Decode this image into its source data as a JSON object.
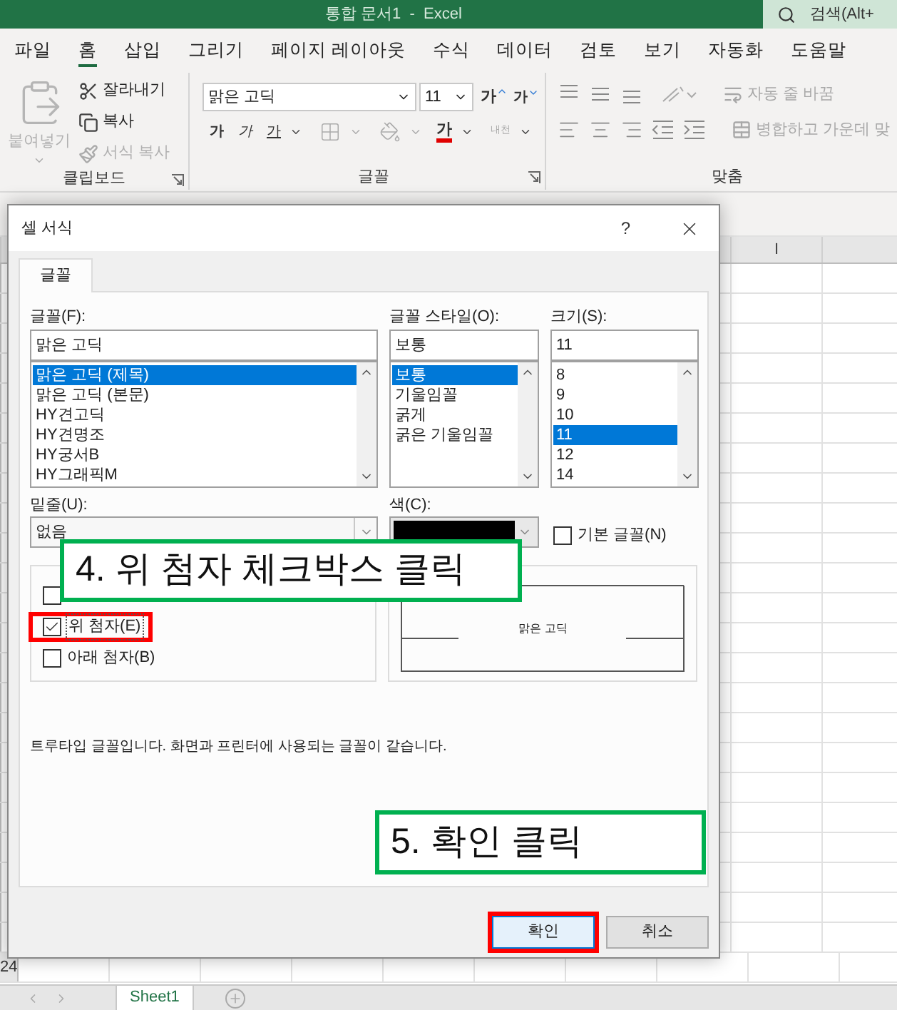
{
  "window": {
    "title": "통합 문서1  -  Excel",
    "search_placeholder": "검색(Alt+"
  },
  "menu_tabs": [
    {
      "label": "파일",
      "selected": false
    },
    {
      "label": "홈",
      "selected": true
    },
    {
      "label": "삽입",
      "selected": false
    },
    {
      "label": "그리기",
      "selected": false
    },
    {
      "label": "페이지 레이아웃",
      "selected": false
    },
    {
      "label": "수식",
      "selected": false
    },
    {
      "label": "데이터",
      "selected": false
    },
    {
      "label": "검토",
      "selected": false
    },
    {
      "label": "보기",
      "selected": false
    },
    {
      "label": "자동화",
      "selected": false
    },
    {
      "label": "도움말",
      "selected": false
    }
  ],
  "ribbon": {
    "clipboard": {
      "paste": {
        "label": "붙여넣기",
        "disabled": true
      },
      "items": [
        {
          "kind": "cut",
          "label": "잘라내기",
          "disabled": false
        },
        {
          "kind": "copy",
          "label": "복사",
          "disabled": false
        },
        {
          "kind": "format_painter",
          "label": "서식 복사",
          "disabled": true
        }
      ],
      "group_label": "클립보드"
    },
    "font": {
      "font_name": "맑은 고딕",
      "font_size": "11",
      "grow": "가",
      "shrink": "가",
      "bold": "가",
      "italic": "가",
      "underline": "가",
      "font_color": "가",
      "phonetic": "내천",
      "group_label": "글꼴"
    },
    "alignment": {
      "wrap_text": {
        "label": "자동 줄 바꿈",
        "disabled": true
      },
      "merge": {
        "label": "병합하고 가운데 맞",
        "disabled": true
      },
      "group_label": "맞춤"
    }
  },
  "sheet": {
    "column_header": "I",
    "row_number": "24",
    "sheet_tabs": [
      {
        "label": "Sheet1",
        "selected": true
      }
    ]
  },
  "dialog": {
    "title": "셀 서식",
    "help": "?",
    "tabs": [
      {
        "label": "글꼴",
        "selected": true
      }
    ],
    "font": {
      "label": "글꼴(F):",
      "value": "맑은 고딕",
      "items": [
        {
          "label": "맑은 고딕 (제목)",
          "selected": true
        },
        {
          "label": "맑은 고딕 (본문)",
          "selected": false
        },
        {
          "label": "HY견고딕",
          "selected": false
        },
        {
          "label": "HY견명조",
          "selected": false
        },
        {
          "label": "HY궁서B",
          "selected": false
        },
        {
          "label": "HY그래픽M",
          "selected": false
        }
      ]
    },
    "style": {
      "label": "글꼴 스타일(O):",
      "value": "보통",
      "items": [
        {
          "label": "보통",
          "selected": true
        },
        {
          "label": "기울임꼴",
          "selected": false
        },
        {
          "label": "굵게",
          "selected": false
        },
        {
          "label": "굵은 기울임꼴",
          "selected": false
        }
      ]
    },
    "size": {
      "label": "크기(S):",
      "value": "11",
      "items": [
        {
          "label": "8",
          "selected": false
        },
        {
          "label": "9",
          "selected": false
        },
        {
          "label": "10",
          "selected": false
        },
        {
          "label": "11",
          "selected": true
        },
        {
          "label": "12",
          "selected": false
        },
        {
          "label": "14",
          "selected": false
        }
      ]
    },
    "underline": {
      "label": "밑줄(U):",
      "value": "없음"
    },
    "color": {
      "label": "색(C):",
      "color": "#000000"
    },
    "normal_font": {
      "label": "기본 글꼴(N)",
      "checked": false
    },
    "effects": [
      {
        "checked": false,
        "highlighted": false
      },
      {
        "label": "위 첨자(E)",
        "checked": true,
        "highlighted": true
      },
      {
        "label": "아래 첨자(B)",
        "checked": false,
        "highlighted": false
      }
    ],
    "preview": "맑은 고딕",
    "info": "트루타입 글꼴입니다. 화면과 프린터에 사용되는 글꼴이 같습니다.",
    "buttons": [
      {
        "label": "확인",
        "default": true,
        "highlighted": true
      },
      {
        "label": "취소",
        "default": false,
        "highlighted": false
      }
    ]
  },
  "annotations": [
    {
      "text": "4. 위 첨자 체크박스 클릭"
    },
    {
      "text": "5. 확인 클릭"
    }
  ]
}
